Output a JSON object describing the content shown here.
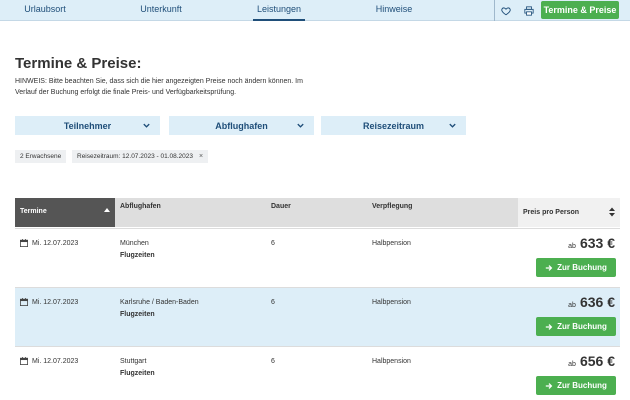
{
  "nav": {
    "tabs": [
      {
        "label": "Urlaubsort"
      },
      {
        "label": "Unterkunft"
      },
      {
        "label": "Leistungen",
        "active": true
      },
      {
        "label": "Hinweise"
      }
    ],
    "cta": "Termine & Preise",
    "icons": [
      "heart-icon",
      "print-icon"
    ]
  },
  "page": {
    "title": "Termine & Preise:",
    "hint": "HINWEIS: Bitte beachten Sie, dass sich die hier angezeigten Preise noch ändern können. Im Verlauf der Buchung erfolgt die finale Preis- und Verfügbarkeitsprüfung."
  },
  "filters": [
    {
      "label": "Teilnehmer"
    },
    {
      "label": "Abflughafen"
    },
    {
      "label": "Reisezeitraum"
    }
  ],
  "tags": [
    {
      "label": "2 Erwachsene"
    },
    {
      "label": "Reisezeitraum: 12.07.2023 - 01.08.2023",
      "remove": "×"
    }
  ],
  "table": {
    "headers": {
      "termine": "Termine",
      "abflughafen": "Abflughafen",
      "dauer": "Dauer",
      "verpflegung": "Verpflegung",
      "preis": "Preis pro Person"
    },
    "rows": [
      {
        "date": "Mi. 12.07.2023",
        "airport": "München",
        "flights": "Flugzeiten",
        "duration": "6",
        "board": "Halbpension",
        "price_prefix": "ab",
        "price": "633 €",
        "book": "Zur Buchung"
      },
      {
        "date": "Mi. 12.07.2023",
        "airport": "Karlsruhe / Baden-Baden",
        "flights": "Flugzeiten",
        "duration": "6",
        "board": "Halbpension",
        "price_prefix": "ab",
        "price": "636 €",
        "book": "Zur Buchung"
      },
      {
        "date": "Mi. 12.07.2023",
        "airport": "Stuttgart",
        "flights": "Flugzeiten",
        "duration": "6",
        "board": "Halbpension",
        "price_prefix": "ab",
        "price": "656 €",
        "book": "Zur Buchung"
      }
    ]
  },
  "colors": {
    "accent": "#4caf50",
    "nav_bg": "#ddeef8",
    "nav_text": "#1f4e79",
    "header_dark": "#555555"
  }
}
